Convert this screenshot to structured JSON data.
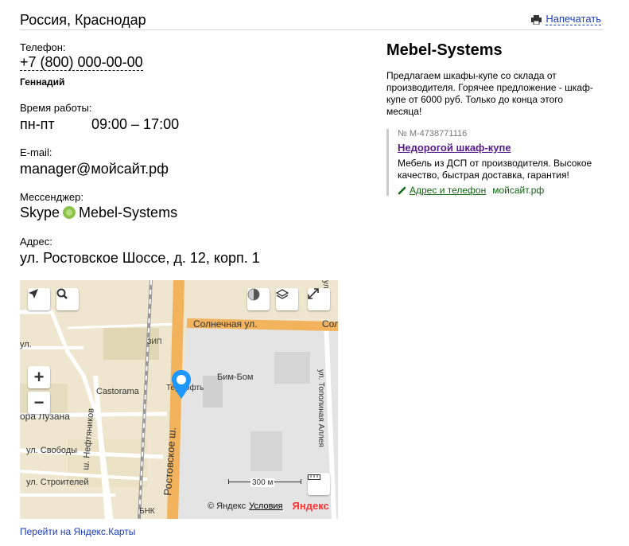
{
  "header": {
    "city": "Россия, Краснодар",
    "print_label": "Напечатать"
  },
  "contacts": {
    "phone_label": "Телефон:",
    "phone": "+7 (800) 000-00-00",
    "person": "Геннадий",
    "hours_label": "Время работы:",
    "hours_days": "пн-пт",
    "hours_time": "09:00 – 17:00",
    "email_label": "E-mail:",
    "email": "manager@мойсайт.рф",
    "messenger_label": "Мессенджер:",
    "messenger_service": "Skype",
    "messenger_user": "Mebel-Systems",
    "address_label": "Адрес:",
    "address": "ул. Ростовское Шоссе, д. 12, корп. 1"
  },
  "map": {
    "streets": {
      "solnechnaya": "Солнечная ул.",
      "sol_short": "Сол",
      "rostovskoe": "Ростовское ш.",
      "lyzana": "ора Лузана",
      "svobody": "ул. Свободы",
      "stroiteley": "ул. Строителей",
      "neftyanikov": "ш. Нефтяников",
      "topolinaya": "ул. Тополиная Аллея",
      "ul": "ул.",
      "ul_short": "ул.",
      "bnk": "БНК"
    },
    "pois": {
      "castorama": "Castorama",
      "bimbom": "Бим-Бом",
      "tyfst": "ТерСофть",
      "zip": "ЗИП"
    },
    "scale_label": "300 м",
    "copyright": "© Яндекс",
    "terms": "Условия",
    "logo": "Яндекс"
  },
  "map_link": "Перейти на Яндекс.Карты",
  "ad": {
    "company": "Mebel-Systems",
    "description": "Предлагаем шкафы-купе со склада от производителя. Горячее предложение - шкаф-купе от 6000 руб. Только до конца этого месяца!",
    "number": "№ М-4738771116",
    "link": "Недорогой шкаф-купе",
    "text": "Мебель из ДСП от производителя. Высокое качество, быстрая доставка, гарантия!",
    "contact_link": "Адрес и телефон",
    "site": "мойсайт.рф"
  }
}
